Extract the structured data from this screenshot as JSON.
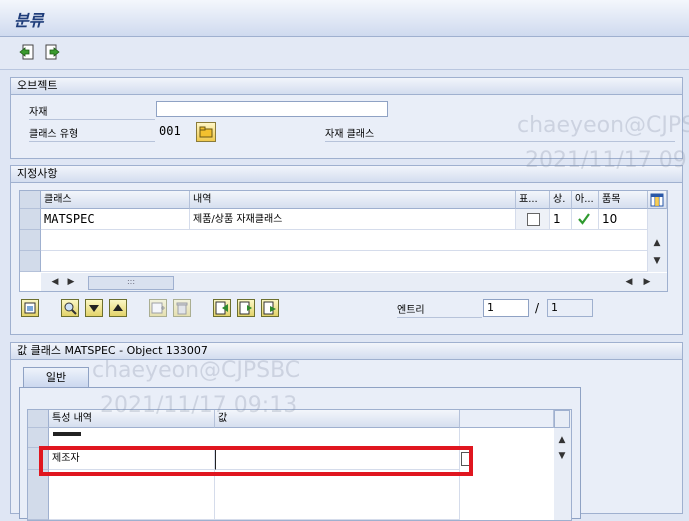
{
  "window": {
    "title": "분류"
  },
  "object_section": {
    "title": "오브젝트",
    "material_label": "자재",
    "material_value": "",
    "class_type_label": "클래스 유형",
    "class_type_value": "001",
    "material_class_label": "자재 클래스"
  },
  "assignment_section": {
    "title": "지정사항",
    "columns": [
      "클래스",
      "내역",
      "표...",
      "상.",
      "아...",
      "품목"
    ],
    "rows": [
      {
        "class": "MATSPEC",
        "desc": "제품/상품 자재클래스",
        "status": "1",
        "item": "10"
      }
    ],
    "entry_label": "엔트리",
    "entry_current": "1",
    "entry_sep": "/",
    "entry_total": "1",
    "scroll_mid": ":::"
  },
  "value_section": {
    "title": "값 클래스 MATSPEC - Object 133007",
    "tab_label": "일반",
    "columns": [
      "특성 내역",
      "값"
    ],
    "rows": [
      {
        "char": "제조자",
        "value": ""
      }
    ]
  },
  "watermark": {
    "line1": "chaeyeon@CJPSBC",
    "line2": "2021/11/17 09:13"
  },
  "colors": {
    "highlight": "#e0161f",
    "accent": "#1f3d7a"
  }
}
